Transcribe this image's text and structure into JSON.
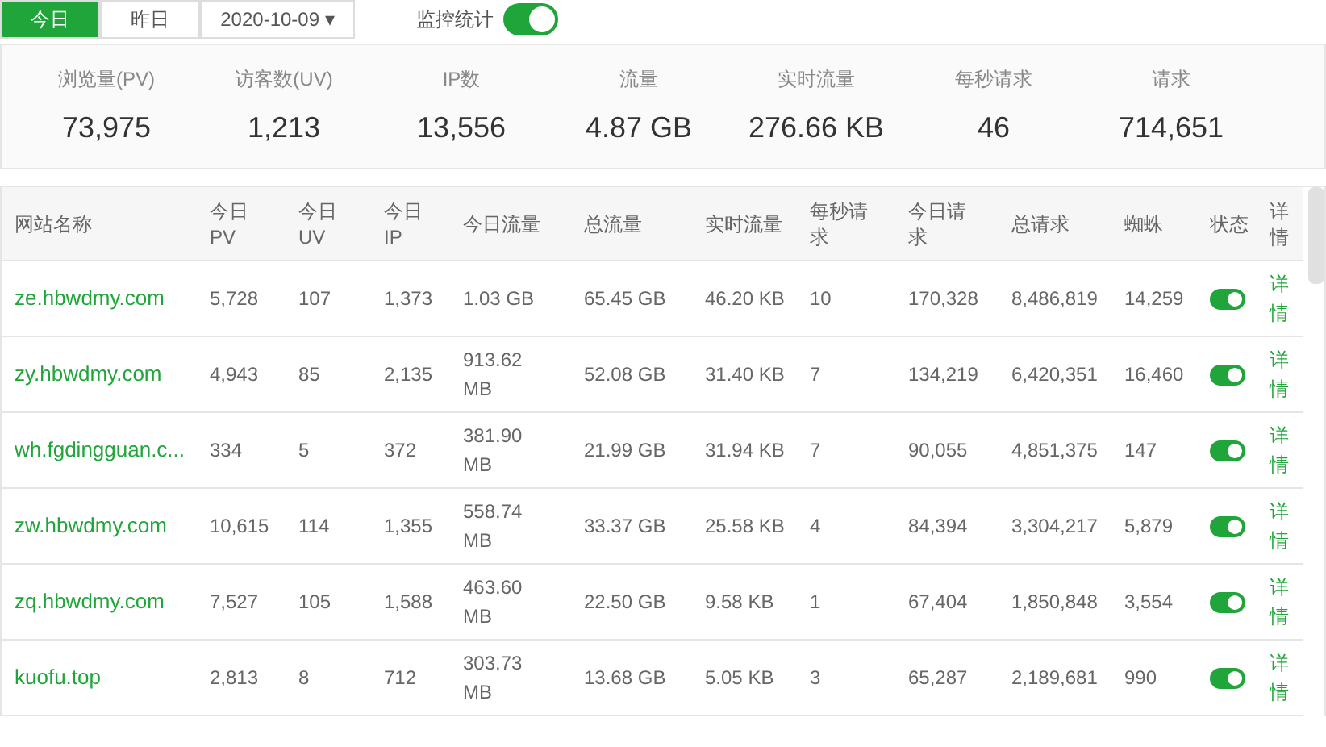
{
  "toolbar": {
    "tabs": [
      {
        "label": "今日",
        "selected": true
      },
      {
        "label": "昨日",
        "selected": false
      }
    ],
    "date": {
      "value": "2020-10-09",
      "caret": "▾"
    },
    "monitor": {
      "label": "监控统计",
      "on": true
    }
  },
  "stats": [
    {
      "label": "浏览量(PV)",
      "value": "73,975"
    },
    {
      "label": "访客数(UV)",
      "value": "1,213"
    },
    {
      "label": "IP数",
      "value": "13,556"
    },
    {
      "label": "流量",
      "value": "4.87 GB"
    },
    {
      "label": "实时流量",
      "value": "276.66 KB"
    },
    {
      "label": "每秒请求",
      "value": "46"
    },
    {
      "label": "请求",
      "value": "714,651"
    }
  ],
  "table": {
    "columns": [
      "网站名称",
      "今日PV",
      "今日UV",
      "今日IP",
      "今日流量",
      "总流量",
      "实时流量",
      "每秒请求",
      "今日请求",
      "总请求",
      "蜘蛛",
      "状态",
      "详情"
    ],
    "rows": [
      {
        "cells": [
          "ze.hbwdmy.com",
          "5,728",
          "107",
          "1,373",
          "1.03 GB",
          "65.45 GB",
          "46.20 KB",
          "10",
          "170,328",
          "8,486,819",
          "14,259"
        ],
        "on": true,
        "action": "详情"
      },
      {
        "cells": [
          "zy.hbwdmy.com",
          "4,943",
          "85",
          "2,135",
          "913.62 MB",
          "52.08 GB",
          "31.40 KB",
          "7",
          "134,219",
          "6,420,351",
          "16,460"
        ],
        "on": true,
        "action": "详情"
      },
      {
        "cells": [
          "wh.fgdingguan.c...",
          "334",
          "5",
          "372",
          "381.90 MB",
          "21.99 GB",
          "31.94 KB",
          "7",
          "90,055",
          "4,851,375",
          "147"
        ],
        "on": true,
        "action": "详情"
      },
      {
        "cells": [
          "zw.hbwdmy.com",
          "10,615",
          "114",
          "1,355",
          "558.74 MB",
          "33.37 GB",
          "25.58 KB",
          "4",
          "84,394",
          "3,304,217",
          "5,879"
        ],
        "on": true,
        "action": "详情"
      },
      {
        "cells": [
          "zq.hbwdmy.com",
          "7,527",
          "105",
          "1,588",
          "463.60 MB",
          "22.50 GB",
          "9.58 KB",
          "1",
          "67,404",
          "1,850,848",
          "3,554"
        ],
        "on": true,
        "action": "详情"
      },
      {
        "cells": [
          "kuofu.top",
          "2,813",
          "8",
          "712",
          "303.73 MB",
          "13.68 GB",
          "5.05 KB",
          "3",
          "65,287",
          "2,189,681",
          "990"
        ],
        "on": true,
        "action": "详情"
      }
    ]
  }
}
